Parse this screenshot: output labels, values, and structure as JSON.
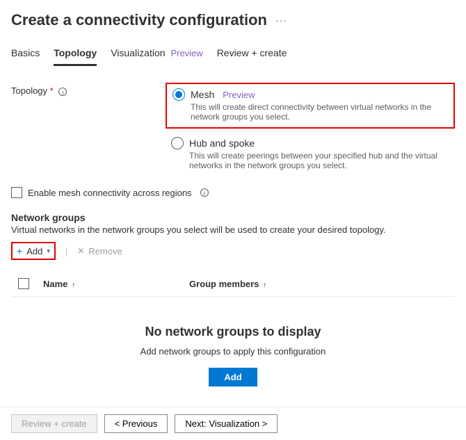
{
  "header": {
    "title": "Create a connectivity configuration"
  },
  "tabs": {
    "basics": "Basics",
    "topology": "Topology",
    "visualization": "Visualization",
    "visualization_badge": "Preview",
    "review": "Review + create"
  },
  "form": {
    "topology_label": "Topology",
    "mesh": {
      "label": "Mesh",
      "badge": "Preview",
      "desc": "This will create direct connectivity between virtual networks in the network groups you select."
    },
    "hubspoke": {
      "label": "Hub and spoke",
      "desc": "This will create peerings between your specified hub and the virtual networks in the network groups you select."
    },
    "mesh_regions": "Enable mesh connectivity across regions"
  },
  "network_groups": {
    "title": "Network groups",
    "desc": "Virtual networks in the network groups you select will be used to create your desired topology.",
    "add_label": "Add",
    "remove_label": "Remove",
    "col_name": "Name",
    "col_members": "Group members",
    "empty_title": "No network groups to display",
    "empty_desc": "Add network groups to apply this configuration",
    "empty_button": "Add"
  },
  "footer": {
    "review": "Review + create",
    "previous": "< Previous",
    "next": "Next: Visualization >"
  }
}
